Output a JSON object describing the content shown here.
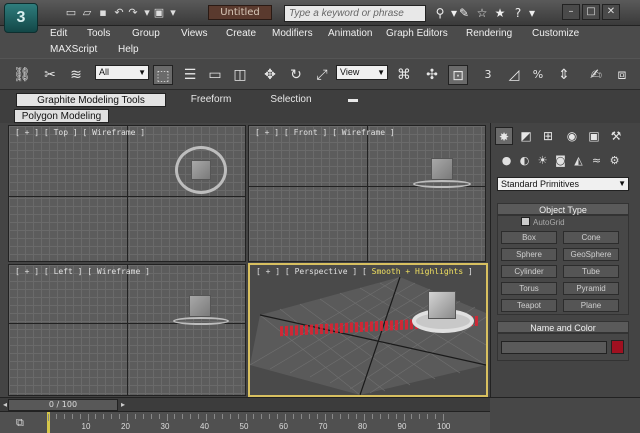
{
  "app": {
    "logo": "3",
    "title": "Untitled",
    "search_placeholder": "Type a keyword or phrase"
  },
  "quick_access": [
    "new-icon",
    "open-icon",
    "save-icon",
    "undo-icon",
    "redo-icon",
    "project-icon"
  ],
  "menu": {
    "row1": [
      "Edit",
      "Tools",
      "Group",
      "Views",
      "Create",
      "Modifiers",
      "Animation",
      "Graph Editors",
      "Rendering",
      "Customize"
    ],
    "row2": [
      "MAXScript",
      "Help"
    ]
  },
  "toolbar": {
    "selection_filter": "All",
    "reference_coord": "View",
    "snap_labels": [
      "3",
      "%"
    ]
  },
  "ribbon": {
    "tabs": [
      "Graphite Modeling Tools",
      "Freeform",
      "Selection"
    ],
    "sub_tab": "Polygon Modeling"
  },
  "viewports": {
    "top": {
      "plus": "+",
      "name": "Top",
      "mode": "Wireframe"
    },
    "front": {
      "plus": "+",
      "name": "Front",
      "mode": "Wireframe"
    },
    "left": {
      "plus": "+",
      "name": "Left",
      "mode": "Wireframe"
    },
    "perspective": {
      "plus": "+",
      "name": "Perspective",
      "mode": "Smooth + Highlights"
    }
  },
  "command_panel": {
    "category_dropdown": "Standard Primitives",
    "object_type": {
      "title": "Object Type",
      "autogrid": "AutoGrid",
      "buttons": [
        "Box",
        "Cone",
        "Sphere",
        "GeoSphere",
        "Cylinder",
        "Tube",
        "Torus",
        "Pyramid",
        "Teapot",
        "Plane"
      ]
    },
    "name_and_color": {
      "title": "Name and Color",
      "color": "#a01020"
    }
  },
  "timeline": {
    "slider_label": "0 / 100",
    "ticks": [
      "10",
      "20",
      "30",
      "40",
      "50",
      "60",
      "70",
      "80",
      "90",
      "100"
    ]
  },
  "colors": {
    "accent_active_viewport": "#d8c060",
    "selection_red": "#e02030"
  }
}
